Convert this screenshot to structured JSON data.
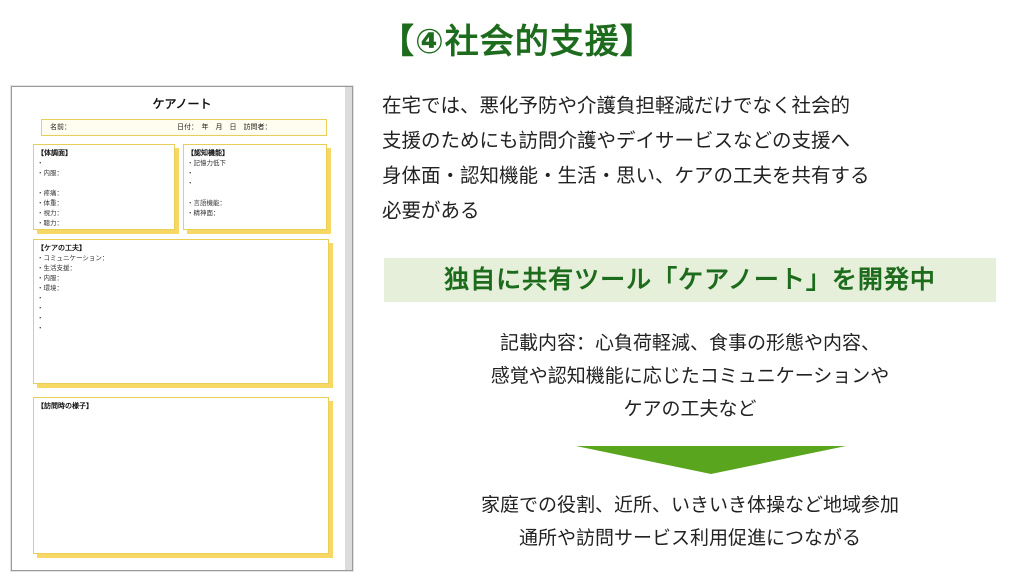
{
  "title": "【④社会的支援】",
  "care_note": {
    "title": "ケアノート",
    "name_label": "名前：",
    "date_label": "日付：　年　月　日　訪問者：",
    "body_box": {
      "title": "【体調面】",
      "lines": [
        "・",
        "・内服：",
        "",
        "・疼痛：",
        "・体重：",
        "・視力：",
        "・聴力："
      ]
    },
    "cognitive_box": {
      "title": "【認知機能】",
      "lines": [
        "・記憶力低下",
        "・",
        "・",
        "",
        "・言語機能：",
        "・精神面："
      ]
    },
    "care_box": {
      "title": "【ケアの工夫】",
      "lines": [
        "・コミュニケーション：",
        "・生活支援：",
        "・内服：",
        "・環境：",
        "・",
        "・",
        "・",
        "・"
      ]
    },
    "visit_box": {
      "title": "【訪問時の様子】"
    }
  },
  "paragraph": [
    "在宅では、悪化予防や介護負担軽減だけでなく社会的",
    "支援のためにも訪問介護やデイサービスなどの支援へ",
    "身体面・認知機能・生活・思い、ケアの工夫を共有する",
    "必要がある"
  ],
  "highlight": "独自に共有ツール「ケアノート」を開発中",
  "contents": [
    "記載内容：心負荷軽減、食事の形態や内容、",
    "感覚や認知機能に応じたコミュニケーションや",
    "ケアの工夫など"
  ],
  "result": [
    "家庭での役割、近所、いきいき体操など地域参加",
    "通所や訪問サービス利用促進につながる"
  ],
  "colors": {
    "accent_green": "#1d6b1d",
    "highlight_bg": "#e6efd9",
    "arrow_green": "#5aa51e",
    "note_yellow": "#f7d865"
  }
}
